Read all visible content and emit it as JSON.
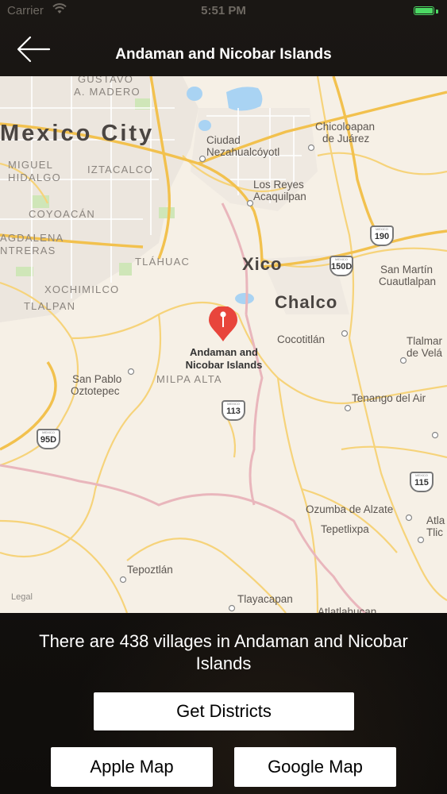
{
  "status_bar": {
    "carrier": "Carrier",
    "time": "5:51 PM",
    "battery_level": 1.0,
    "battery_color": "#4cd964"
  },
  "nav": {
    "back_icon": "arrow-left-icon",
    "title": "Andaman and Nicobar Islands"
  },
  "map": {
    "labels": {
      "gustavo": "GUSTAVO",
      "madero": "A. MADERO",
      "mexico_city": "Mexico City",
      "miguel": "MIGUEL",
      "hidalgo": "HIDALGO",
      "iztacalco": "IZTACALCO",
      "coyoacan": "COYOACÁN",
      "agdalena": "AGDALENA",
      "ntreras": "NTRERAS",
      "tlahuac": "TLÁHUAC",
      "xochimilco": "XOCHIMILCO",
      "tlalpan": "TLALPAN",
      "milpa_alta": "MILPA ALTA",
      "ciudad": "Ciudad",
      "nezahualcoyotl": "Nezahualcóyotl",
      "chicoloapan": "Chicoloapan",
      "de_juarez": "de Juárez",
      "los_reyes": "Los Reyes",
      "acaquilpan": "Acaquilpan",
      "xico": "Xico",
      "chalco": "Chalco",
      "san_martin": "San Martín",
      "cuautlalpan": "Cuautlalpan",
      "cocotitlan": "Cocotitlán",
      "tlalmanalco": "Tlalmar",
      "de_velasco": "de Velá",
      "san_pablo": "San Pablo",
      "oztotepec": "Oztotepec",
      "tenango": "Tenango del Air",
      "ozumba": "Ozumba de Alzate",
      "tepetlixpa": "Tepetlixpa",
      "atla": "Atla",
      "tlicu": "Tlic",
      "tepoztlan": "Tepoztlán",
      "tlayacapan": "Tlayacapan",
      "atlatlahucan": "Atlatlahucan",
      "legal": "Legal"
    },
    "pin": {
      "icon": "map-pin-icon",
      "color": "#e8453c",
      "label_line1": "Andaman and",
      "label_line2": "Nicobar Islands"
    },
    "shields": {
      "s190": "190",
      "s150d": "150D",
      "s113": "113",
      "s95d": "95D",
      "s115": "115"
    }
  },
  "info": {
    "villages_text": "There are 438 villages in Andaman and Nicobar Islands"
  },
  "buttons": {
    "get_districts": "Get Districts",
    "apple_map": "Apple Map",
    "google_map": "Google Map"
  }
}
